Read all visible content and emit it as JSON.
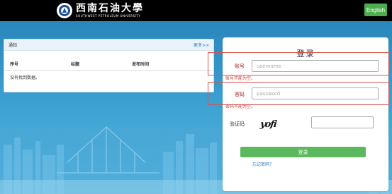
{
  "header": {
    "logo_cn": "西南石油大學",
    "logo_en": "SOUTHWEST PETROLEUM UNIVERSITY",
    "lang_button": "English"
  },
  "notice": {
    "title": "通知",
    "more": "更多>>",
    "columns": [
      "序号",
      "标题",
      "发布时间"
    ],
    "empty_text": "没有找到数据。"
  },
  "login": {
    "title": "登录",
    "username_label": "账号",
    "username_placeholder": "username",
    "username_error": "账号不能为空。",
    "password_label": "密码",
    "password_placeholder": "password",
    "password_error": "密码不能为空。",
    "captcha_label": "验证码",
    "captcha_text": "yofi",
    "captcha_value": "",
    "submit": "登录",
    "forgot": "忘记密码？"
  },
  "colors": {
    "accent_green": "#5cb85c",
    "error_red": "#d9534f",
    "link_blue": "#3377bb",
    "background_blue": "#2f8fc0"
  }
}
